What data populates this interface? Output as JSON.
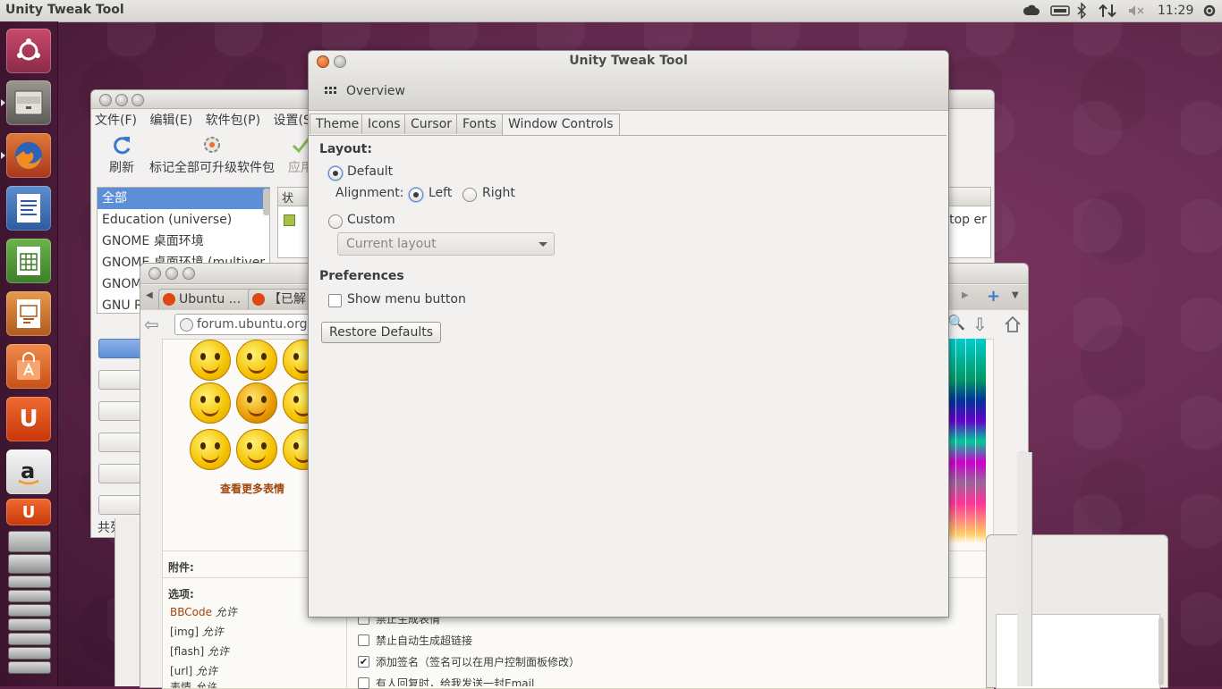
{
  "top_panel": {
    "title": "Unity Tweak Tool",
    "clock": "11:29"
  },
  "launcher": {
    "items": [
      "ubuntu-dash",
      "files",
      "firefox",
      "libreoffice-writer",
      "libreoffice-calc",
      "libreoffice-impress",
      "software-center",
      "ubuntu-one",
      "amazon",
      "ubuntu-one-music",
      "system-settings",
      "software-updater",
      "workspaces"
    ]
  },
  "synaptic": {
    "menu": [
      "文件(F)",
      "编辑(E)",
      "软件包(P)",
      "设置(S)"
    ],
    "toolbar": {
      "refresh": "刷新",
      "mark_all": "标记全部可升级软件包",
      "apply": "应用"
    },
    "sections": [
      "全部",
      "Education (universe)",
      "GNOME 桌面环境",
      "GNOME 桌面环境 (multiver",
      "GNOM",
      "GNU R"
    ],
    "column_header": "状",
    "cell_text": "ktop er",
    "status": "共列出"
  },
  "firefox": {
    "tabs": [
      "Ubuntu ...",
      "【已解"
    ],
    "url": "forum.ubuntu.org.",
    "more_emoticons": "查看更多表情",
    "attachments_label": "附件:",
    "options_label": "选项:",
    "options": [
      {
        "name": "BBCode",
        "value": "允许"
      },
      {
        "name": "[img]",
        "value": "允许"
      },
      {
        "name": "[flash]",
        "value": "允许"
      },
      {
        "name": "[url]",
        "value": "允许"
      },
      {
        "name": "表情",
        "value": "允许"
      }
    ],
    "checkboxes": [
      {
        "label": "禁止生成表情",
        "checked": false
      },
      {
        "label": "禁止自动生成超链接",
        "checked": false
      },
      {
        "label": "添加签名（签名可以在用户控制面板修改）",
        "checked": true
      },
      {
        "label": "有人回复时，给我发送一封Email",
        "checked": false
      }
    ]
  },
  "utt": {
    "title": "Unity Tweak Tool",
    "overview": "Overview",
    "tabs": [
      "Theme",
      "Icons",
      "Cursor",
      "Fonts",
      "Window Controls"
    ],
    "active_tab": "Window Controls",
    "layout": {
      "heading": "Layout:",
      "default": "Default",
      "alignment_label": "Alignment:",
      "left": "Left",
      "right": "Right",
      "custom": "Custom",
      "combo": "Current layout"
    },
    "preferences": {
      "heading": "Preferences",
      "show_menu_button": "Show menu button"
    },
    "restore": "Restore Defaults"
  }
}
